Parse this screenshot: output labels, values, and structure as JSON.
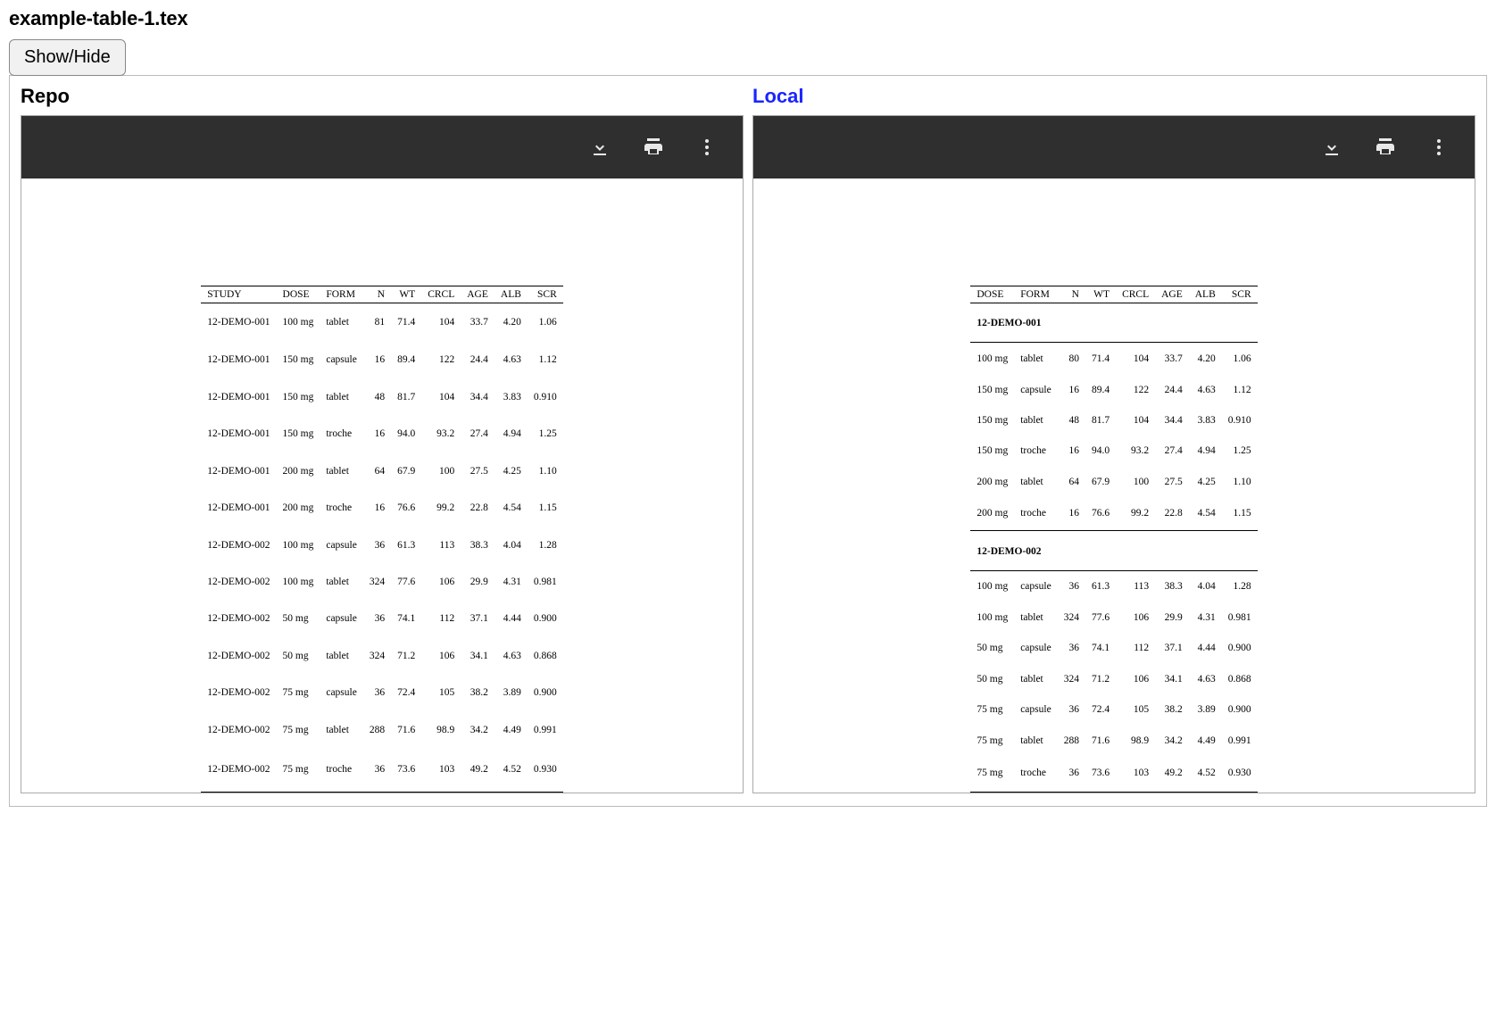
{
  "title": "example-table-1.tex",
  "showhide_label": "Show/Hide",
  "panes": {
    "repo": {
      "label": "Repo"
    },
    "local": {
      "label": "Local"
    }
  },
  "columns": {
    "study": "STUDY",
    "dose": "DOSE",
    "form": "FORM",
    "n": "N",
    "wt": "WT",
    "crcl": "CRCL",
    "age": "AGE",
    "alb": "ALB",
    "scr": "SCR"
  },
  "chart_data": {
    "type": "table",
    "repo": {
      "columns": [
        "STUDY",
        "DOSE",
        "FORM",
        "N",
        "WT",
        "CRCL",
        "AGE",
        "ALB",
        "SCR"
      ],
      "rows": [
        {
          "study": "12-DEMO-001",
          "dose": "100 mg",
          "form": "tablet",
          "n": "81",
          "wt": "71.4",
          "crcl": "104",
          "age": "33.7",
          "alb": "4.20",
          "scr": "1.06"
        },
        {
          "study": "12-DEMO-001",
          "dose": "150 mg",
          "form": "capsule",
          "n": "16",
          "wt": "89.4",
          "crcl": "122",
          "age": "24.4",
          "alb": "4.63",
          "scr": "1.12"
        },
        {
          "study": "12-DEMO-001",
          "dose": "150 mg",
          "form": "tablet",
          "n": "48",
          "wt": "81.7",
          "crcl": "104",
          "age": "34.4",
          "alb": "3.83",
          "scr": "0.910"
        },
        {
          "study": "12-DEMO-001",
          "dose": "150 mg",
          "form": "troche",
          "n": "16",
          "wt": "94.0",
          "crcl": "93.2",
          "age": "27.4",
          "alb": "4.94",
          "scr": "1.25"
        },
        {
          "study": "12-DEMO-001",
          "dose": "200 mg",
          "form": "tablet",
          "n": "64",
          "wt": "67.9",
          "crcl": "100",
          "age": "27.5",
          "alb": "4.25",
          "scr": "1.10"
        },
        {
          "study": "12-DEMO-001",
          "dose": "200 mg",
          "form": "troche",
          "n": "16",
          "wt": "76.6",
          "crcl": "99.2",
          "age": "22.8",
          "alb": "4.54",
          "scr": "1.15"
        },
        {
          "study": "12-DEMO-002",
          "dose": "100 mg",
          "form": "capsule",
          "n": "36",
          "wt": "61.3",
          "crcl": "113",
          "age": "38.3",
          "alb": "4.04",
          "scr": "1.28"
        },
        {
          "study": "12-DEMO-002",
          "dose": "100 mg",
          "form": "tablet",
          "n": "324",
          "wt": "77.6",
          "crcl": "106",
          "age": "29.9",
          "alb": "4.31",
          "scr": "0.981"
        },
        {
          "study": "12-DEMO-002",
          "dose": "50 mg",
          "form": "capsule",
          "n": "36",
          "wt": "74.1",
          "crcl": "112",
          "age": "37.1",
          "alb": "4.44",
          "scr": "0.900"
        },
        {
          "study": "12-DEMO-002",
          "dose": "50 mg",
          "form": "tablet",
          "n": "324",
          "wt": "71.2",
          "crcl": "106",
          "age": "34.1",
          "alb": "4.63",
          "scr": "0.868"
        },
        {
          "study": "12-DEMO-002",
          "dose": "75 mg",
          "form": "capsule",
          "n": "36",
          "wt": "72.4",
          "crcl": "105",
          "age": "38.2",
          "alb": "3.89",
          "scr": "0.900"
        },
        {
          "study": "12-DEMO-002",
          "dose": "75 mg",
          "form": "tablet",
          "n": "288",
          "wt": "71.6",
          "crcl": "98.9",
          "age": "34.2",
          "alb": "4.49",
          "scr": "0.991"
        },
        {
          "study": "12-DEMO-002",
          "dose": "75 mg",
          "form": "troche",
          "n": "36",
          "wt": "73.6",
          "crcl": "103",
          "age": "49.2",
          "alb": "4.52",
          "scr": "0.930"
        }
      ]
    },
    "local": {
      "columns": [
        "DOSE",
        "FORM",
        "N",
        "WT",
        "CRCL",
        "AGE",
        "ALB",
        "SCR"
      ],
      "groups": [
        {
          "label": "12-DEMO-001",
          "rows": [
            {
              "dose": "100 mg",
              "form": "tablet",
              "n": "80",
              "wt": "71.4",
              "crcl": "104",
              "age": "33.7",
              "alb": "4.20",
              "scr": "1.06"
            },
            {
              "dose": "150 mg",
              "form": "capsule",
              "n": "16",
              "wt": "89.4",
              "crcl": "122",
              "age": "24.4",
              "alb": "4.63",
              "scr": "1.12"
            },
            {
              "dose": "150 mg",
              "form": "tablet",
              "n": "48",
              "wt": "81.7",
              "crcl": "104",
              "age": "34.4",
              "alb": "3.83",
              "scr": "0.910"
            },
            {
              "dose": "150 mg",
              "form": "troche",
              "n": "16",
              "wt": "94.0",
              "crcl": "93.2",
              "age": "27.4",
              "alb": "4.94",
              "scr": "1.25"
            },
            {
              "dose": "200 mg",
              "form": "tablet",
              "n": "64",
              "wt": "67.9",
              "crcl": "100",
              "age": "27.5",
              "alb": "4.25",
              "scr": "1.10"
            },
            {
              "dose": "200 mg",
              "form": "troche",
              "n": "16",
              "wt": "76.6",
              "crcl": "99.2",
              "age": "22.8",
              "alb": "4.54",
              "scr": "1.15"
            }
          ]
        },
        {
          "label": "12-DEMO-002",
          "rows": [
            {
              "dose": "100 mg",
              "form": "capsule",
              "n": "36",
              "wt": "61.3",
              "crcl": "113",
              "age": "38.3",
              "alb": "4.04",
              "scr": "1.28"
            },
            {
              "dose": "100 mg",
              "form": "tablet",
              "n": "324",
              "wt": "77.6",
              "crcl": "106",
              "age": "29.9",
              "alb": "4.31",
              "scr": "0.981"
            },
            {
              "dose": "50 mg",
              "form": "capsule",
              "n": "36",
              "wt": "74.1",
              "crcl": "112",
              "age": "37.1",
              "alb": "4.44",
              "scr": "0.900"
            },
            {
              "dose": "50 mg",
              "form": "tablet",
              "n": "324",
              "wt": "71.2",
              "crcl": "106",
              "age": "34.1",
              "alb": "4.63",
              "scr": "0.868"
            },
            {
              "dose": "75 mg",
              "form": "capsule",
              "n": "36",
              "wt": "72.4",
              "crcl": "105",
              "age": "38.2",
              "alb": "3.89",
              "scr": "0.900"
            },
            {
              "dose": "75 mg",
              "form": "tablet",
              "n": "288",
              "wt": "71.6",
              "crcl": "98.9",
              "age": "34.2",
              "alb": "4.49",
              "scr": "0.991"
            },
            {
              "dose": "75 mg",
              "form": "troche",
              "n": "36",
              "wt": "73.6",
              "crcl": "103",
              "age": "49.2",
              "alb": "4.52",
              "scr": "0.930"
            }
          ]
        }
      ]
    }
  }
}
